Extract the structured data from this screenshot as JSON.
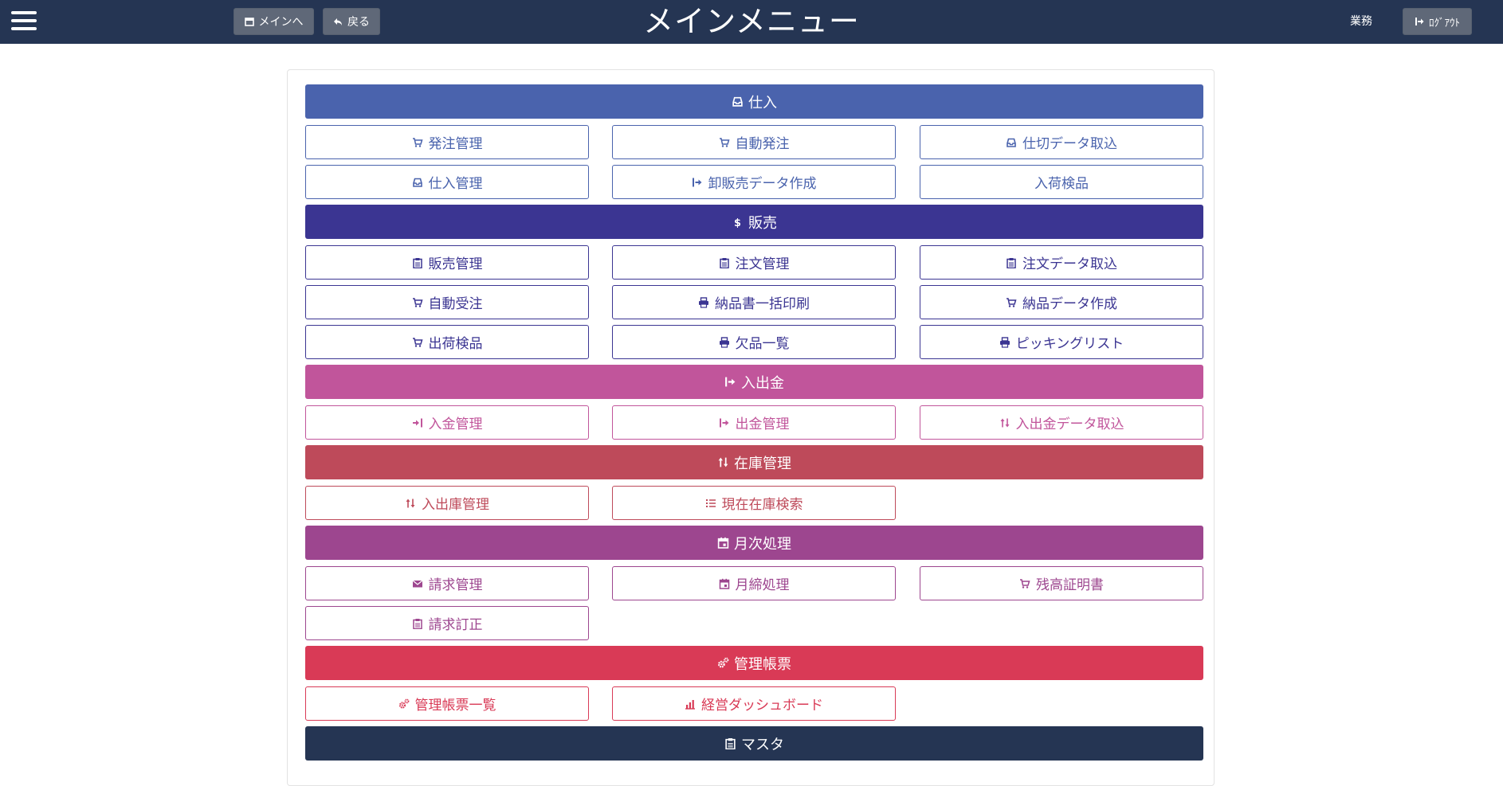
{
  "header": {
    "title": "メインメニュー",
    "main_button": "メインへ",
    "back_button": "戻る",
    "dept_label": "業務",
    "logout_button": "ﾛｸﾞｱｳﾄ",
    "bg_color": "#253553"
  },
  "sections": [
    {
      "label": "仕入",
      "icon": "inbox-icon",
      "color": "#4a63ad",
      "items": [
        {
          "label": "発注管理",
          "icon": "cart-icon"
        },
        {
          "label": "自動発注",
          "icon": "cart-icon"
        },
        {
          "label": "仕切データ取込",
          "icon": "inbox-icon"
        },
        {
          "label": "仕入管理",
          "icon": "inbox-icon"
        },
        {
          "label": "卸販売データ作成",
          "icon": "export-icon"
        },
        {
          "label": "入荷検品",
          "icon": ""
        }
      ]
    },
    {
      "label": "販売",
      "icon": "dollar-icon",
      "color": "#3b3592",
      "items": [
        {
          "label": "販売管理",
          "icon": "clipboard-icon"
        },
        {
          "label": "注文管理",
          "icon": "clipboard-icon"
        },
        {
          "label": "注文データ取込",
          "icon": "clipboard-icon"
        },
        {
          "label": "自動受注",
          "icon": "cart-icon"
        },
        {
          "label": "納品書一括印刷",
          "icon": "print-icon"
        },
        {
          "label": "納品データ作成",
          "icon": "cart-icon"
        },
        {
          "label": "出荷検品",
          "icon": "cart-icon"
        },
        {
          "label": "欠品一覧",
          "icon": "print-icon"
        },
        {
          "label": "ピッキングリスト",
          "icon": "print-icon"
        }
      ]
    },
    {
      "label": "入出金",
      "icon": "export-icon",
      "color": "#c1559b",
      "items": [
        {
          "label": "入金管理",
          "icon": "import-icon"
        },
        {
          "label": "出金管理",
          "icon": "export-icon"
        },
        {
          "label": "入出金データ取込",
          "icon": "sort-icon"
        }
      ]
    },
    {
      "label": "在庫管理",
      "icon": "sort-icon",
      "color": "#be4a5a",
      "items": [
        {
          "label": "入出庫管理",
          "icon": "sort-icon"
        },
        {
          "label": "現在在庫検索",
          "icon": "list-icon"
        }
      ]
    },
    {
      "label": "月次処理",
      "icon": "calendar-icon",
      "color": "#9d468f",
      "items": [
        {
          "label": "請求管理",
          "icon": "envelope-icon"
        },
        {
          "label": "月締処理",
          "icon": "calendar-icon"
        },
        {
          "label": "残高証明書",
          "icon": "cart-icon"
        },
        {
          "label": "請求訂正",
          "icon": "clipboard-icon"
        }
      ]
    },
    {
      "label": "管理帳票",
      "icon": "cogs-icon",
      "color": "#d93a56",
      "items": [
        {
          "label": "管理帳票一覧",
          "icon": "cogs-icon"
        },
        {
          "label": "経営ダッシュボード",
          "icon": "bar-chart-icon"
        }
      ]
    },
    {
      "label": "マスタ",
      "icon": "clipboard-icon",
      "color": "#253553",
      "items": []
    }
  ]
}
